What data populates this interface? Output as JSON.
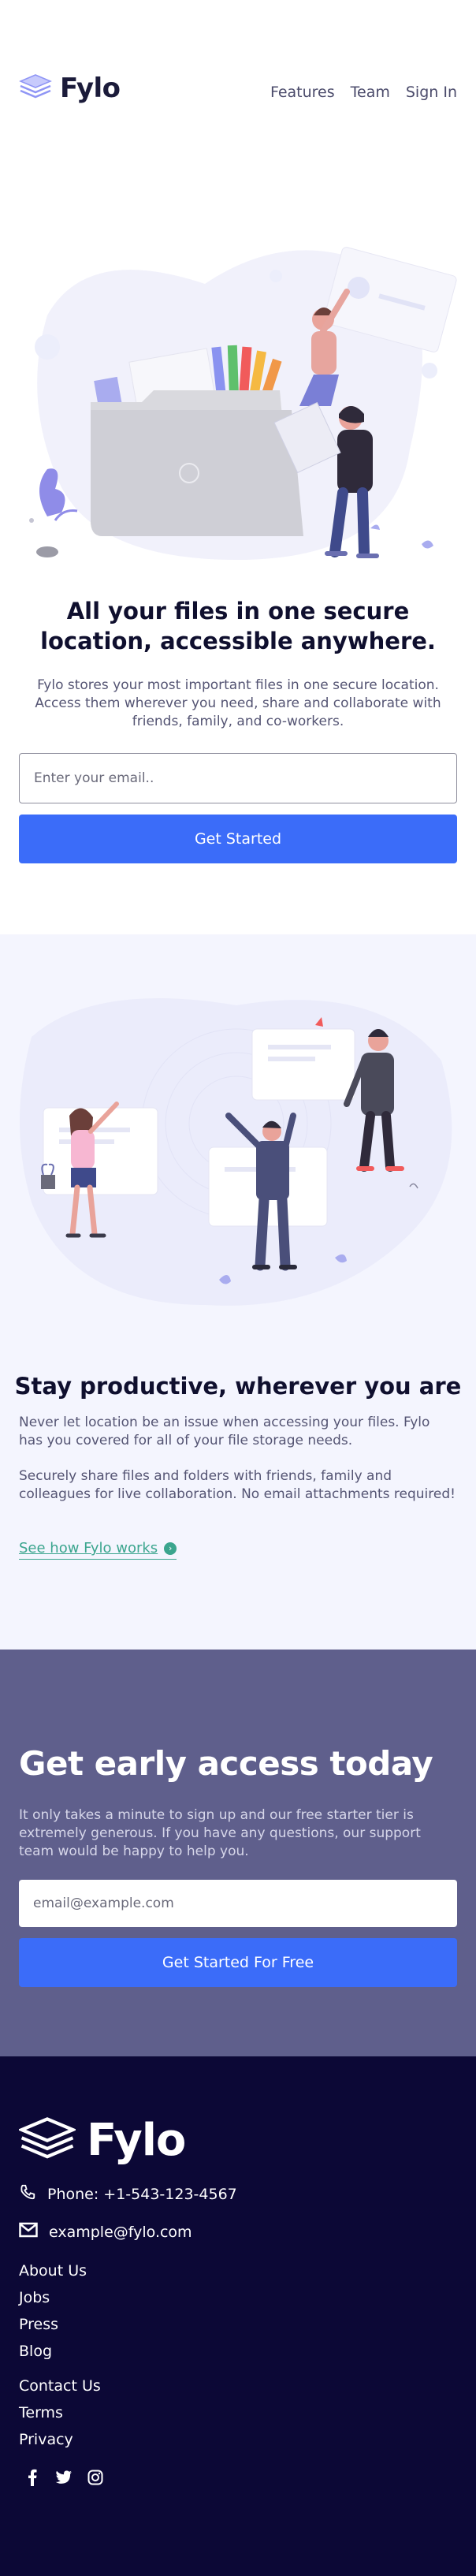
{
  "header": {
    "brand": "Fylo",
    "nav": [
      "Features",
      "Team",
      "Sign In"
    ]
  },
  "hero": {
    "title": "All your files in one secure location, accessible anywhere.",
    "text": "Fylo stores your most important files in one secure location. Access them wherever you need, share and collaborate with friends, family, and co-workers.",
    "email_placeholder": "Enter your email..",
    "button": "Get Started"
  },
  "productive": {
    "title": "Stay productive, wherever you are",
    "paragraph_1": "Never let location be an issue when accessing your files. Fylo has you covered for all of your file storage needs.",
    "paragraph_2": "Securely share files and folders with friends, family and colleagues for live collaboration. No email attachments required!",
    "link": "See how Fylo works"
  },
  "early": {
    "title": "Get early access today",
    "text": "It only takes a minute to sign up and our free starter tier is extremely generous. If you have any questions, our support team would be happy to help you.",
    "email_placeholder": "email@example.com",
    "button": "Get Started For Free"
  },
  "footer": {
    "brand": "Fylo",
    "phone": "Phone: +1-543-123-4567",
    "email": "example@fylo.com",
    "links_1": [
      "About Us",
      "Jobs",
      "Press",
      "Blog"
    ],
    "links_2": [
      "Contact Us",
      "Terms",
      "Privacy"
    ],
    "social": [
      "facebook-icon",
      "twitter-icon",
      "instagram-icon"
    ]
  },
  "colors": {
    "accent": "#3b6cf9",
    "link_green": "#3ba58e",
    "early_bg": "#5f5f8c",
    "footer_bg": "#0c0836",
    "section_bg": "#f4f5fe"
  }
}
